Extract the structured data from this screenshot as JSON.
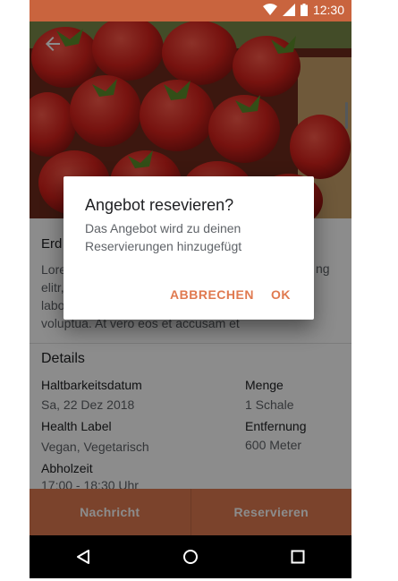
{
  "status_bar": {
    "time": "12:30",
    "icons": [
      "wifi-icon",
      "signal-icon",
      "battery-icon"
    ]
  },
  "offer": {
    "title": "Erd",
    "description_lines": [
      "Lore",
      "elitr,",
      "labo",
      "voluptua. At vero eos et accusam et"
    ],
    "description_trailing": "ng"
  },
  "details": {
    "heading": "Details",
    "best_before_label": "Haltbarkeitsdatum",
    "best_before_value": "Sa, 22 Dez 2018",
    "health_label": "Health Label",
    "health_value": "Vegan, Vegetarisch",
    "pickup_label": "Abholzeit",
    "pickup_value": "17:00 - 18:30 Uhr",
    "quantity_label": "Menge",
    "quantity_value": "1 Schale",
    "distance_label": "Entfernung",
    "distance_value": "600 Meter"
  },
  "actions": {
    "message": "Nachricht",
    "reserve": "Reservieren"
  },
  "dialog": {
    "title": "Angebot resevieren?",
    "body": "Das Angebot wird zu deinen Reservierungen hinzugefügt",
    "cancel": "ABBRECHEN",
    "ok": "OK"
  },
  "colors": {
    "primary": "#e07a50",
    "status_bar": "#c9643e",
    "nav_bar": "#000000"
  }
}
